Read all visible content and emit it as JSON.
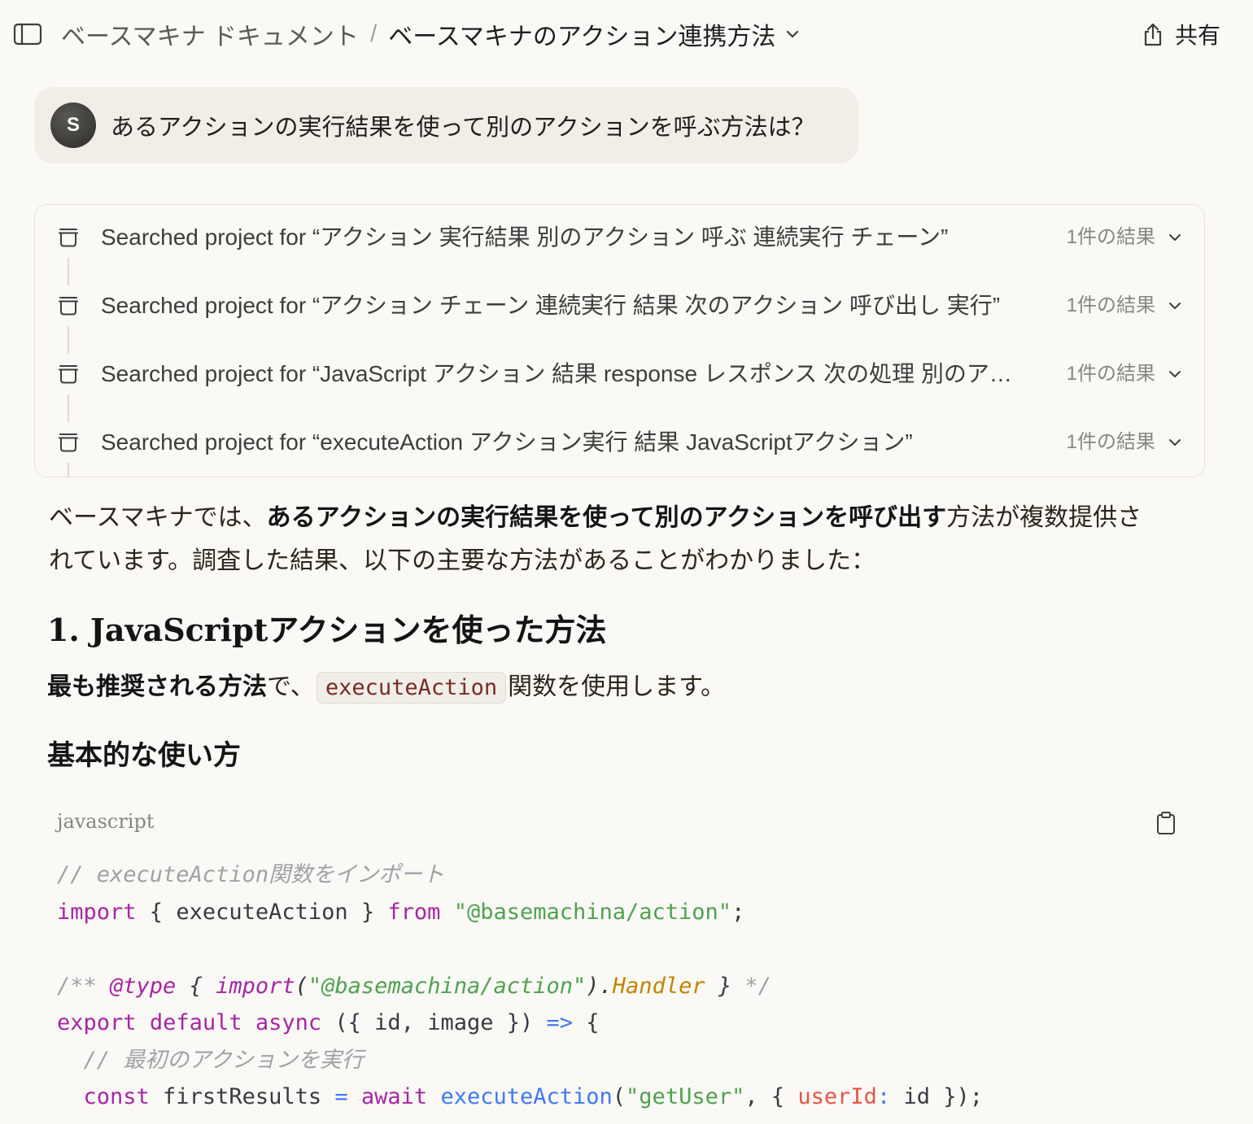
{
  "header": {
    "breadcrumb": {
      "parent": "ベースマキナ ドキュメント",
      "separator": "/",
      "current": "ベースマキナのアクション連携方法"
    },
    "share_label": "共有",
    "icons": {
      "sidebar": "sidebar-toggle-icon",
      "title_dropdown": "chevron-down-icon",
      "share": "share-icon"
    }
  },
  "user_message": {
    "avatar_initial": "S",
    "text": "あるアクションの実行結果を使って別のアクションを呼ぶ方法は？"
  },
  "search": {
    "icon": "archive-box-icon",
    "rows": [
      {
        "text": "Searched project for “アクション 実行結果 別のアクション 呼ぶ 連続実行 チェーン”",
        "result_count": "1件の結果"
      },
      {
        "text": "Searched project for “アクション チェーン 連続実行 結果 次のアクション 呼び出し 実行”",
        "result_count": "1件の結果"
      },
      {
        "text": "Searched project for “JavaScript アクション 結果 response レスポンス 次の処理 別のア…",
        "result_count": "1件の結果"
      },
      {
        "text": "Searched project for “executeAction アクション実行 結果 JavaScriptアクション”",
        "result_count": "1件の結果"
      }
    ]
  },
  "response": {
    "intro": {
      "lead": "ベースマキナでは、",
      "emphasis": "あるアクションの実行結果を使って別のアクションを呼び出す",
      "rest": "方法が複数提供されています。調査した結果、以下の主要な方法があることがわかりました："
    },
    "heading1": "1. JavaScriptアクションを使った方法",
    "method_description": {
      "emphasis": "最も推奨される方法",
      "after_emphasis": "で、",
      "inline_code": "executeAction",
      "rest": "関数を使用します。"
    },
    "heading2": "基本的な使い方",
    "code_block": {
      "language": "javascript",
      "copy_icon": "clipboard-icon",
      "lines": [
        [
          {
            "text": "// executeAction関数をインポート",
            "color": "#a0a1a7",
            "italic": true
          }
        ],
        [
          {
            "text": "import",
            "color": "#a626a4"
          },
          {
            "text": " { executeAction } "
          },
          {
            "text": "from",
            "color": "#a626a4"
          },
          {
            "text": " "
          },
          {
            "text": "\"@basemachina/action\"",
            "color": "#50a14f"
          },
          {
            "text": ";"
          }
        ],
        [],
        [
          {
            "text": "/** ",
            "color": "#a0a1a7",
            "italic": true
          },
          {
            "text": "@type",
            "color": "#a626a4",
            "italic": true
          },
          {
            "text": " { ",
            "italic": true
          },
          {
            "text": "import",
            "color": "#a626a4",
            "italic": true
          },
          {
            "text": "(",
            "italic": true
          },
          {
            "text": "\"@basemachina/action\"",
            "color": "#50a14f",
            "italic": true
          },
          {
            "text": ").",
            "italic": true
          },
          {
            "text": "Handler",
            "color": "#c18401",
            "italic": true
          },
          {
            "text": " } ",
            "italic": true
          },
          {
            "text": "*/",
            "color": "#a0a1a7",
            "italic": true
          }
        ],
        [
          {
            "text": "export",
            "color": "#a626a4"
          },
          {
            "text": " "
          },
          {
            "text": "default",
            "color": "#a626a4"
          },
          {
            "text": " "
          },
          {
            "text": "async",
            "color": "#a626a4"
          },
          {
            "text": " ({ id, image }) "
          },
          {
            "text": "=>",
            "color": "#4078f2"
          },
          {
            "text": " {"
          }
        ],
        [
          {
            "text": "  "
          },
          {
            "text": "// 最初のアクションを実行",
            "color": "#a0a1a7",
            "italic": true
          }
        ],
        [
          {
            "text": "  "
          },
          {
            "text": "const",
            "color": "#a626a4"
          },
          {
            "text": " firstResults "
          },
          {
            "text": "=",
            "color": "#4078f2"
          },
          {
            "text": " "
          },
          {
            "text": "await",
            "color": "#a626a4"
          },
          {
            "text": " "
          },
          {
            "text": "executeAction",
            "color": "#4078f2"
          },
          {
            "text": "("
          },
          {
            "text": "\"getUser\"",
            "color": "#50a14f"
          },
          {
            "text": ", { "
          },
          {
            "text": "userId",
            "color": "#e45649"
          },
          {
            "text": ":",
            "color": "#4078f2"
          },
          {
            "text": " id });"
          }
        ]
      ]
    }
  },
  "theme": {
    "--bg": "#faf9f5",
    "--bubble": "#f0eee6",
    "--text": "#1f1e1d",
    "--muted": "#87867f",
    "--border": "#e6e3da",
    "--inline-code": "#7b2a24",
    "--inline-code-bg": "#f0eee7",
    "--code-plain": "#383a42"
  }
}
